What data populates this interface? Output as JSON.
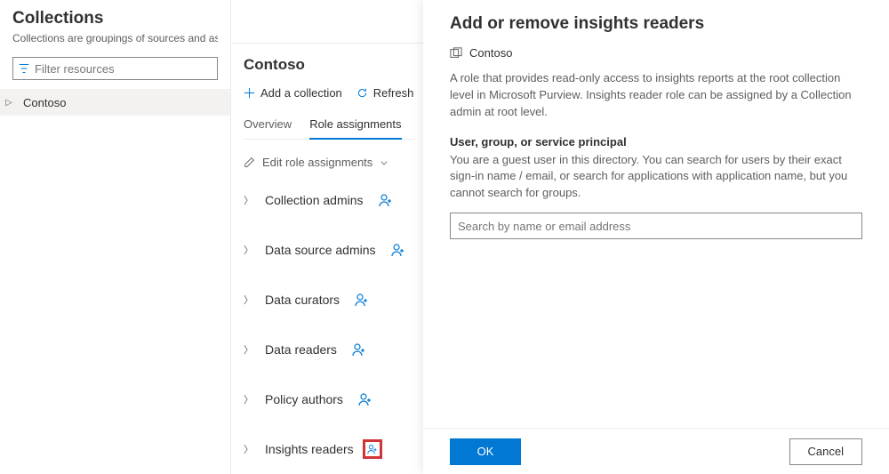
{
  "header": {
    "title": "Collections",
    "subtitle": "Collections are groupings of sources and assets. With a collection, you can take action on all of its content"
  },
  "filter": {
    "placeholder": "Filter resources"
  },
  "tree": {
    "root_label": "Contoso"
  },
  "entity": {
    "title": "Contoso",
    "add_collection_label": "Add a collection",
    "refresh_label": "Refresh",
    "tabs": {
      "overview": "Overview",
      "role_assignments": "Role assignments"
    },
    "edit_dropdown": "Edit role assignments",
    "roles": [
      {
        "label": "Collection admins"
      },
      {
        "label": "Data source admins"
      },
      {
        "label": "Data curators"
      },
      {
        "label": "Data readers"
      },
      {
        "label": "Policy authors"
      },
      {
        "label": "Insights readers",
        "highlighted": true
      }
    ]
  },
  "panel": {
    "title": "Add or remove insights readers",
    "org": "Contoso",
    "description": "A role that provides read-only access to insights reports at the root collection level in Microsoft Purview. Insights reader role can be assigned by a Collection admin at root level.",
    "section_head": "User, group, or service principal",
    "section_sub": "You are a guest user in this directory. You can search for users by their exact sign-in name / email, or search for applications with application name, but you cannot search for groups.",
    "search_placeholder": "Search by name or email address",
    "ok_label": "OK",
    "cancel_label": "Cancel"
  }
}
